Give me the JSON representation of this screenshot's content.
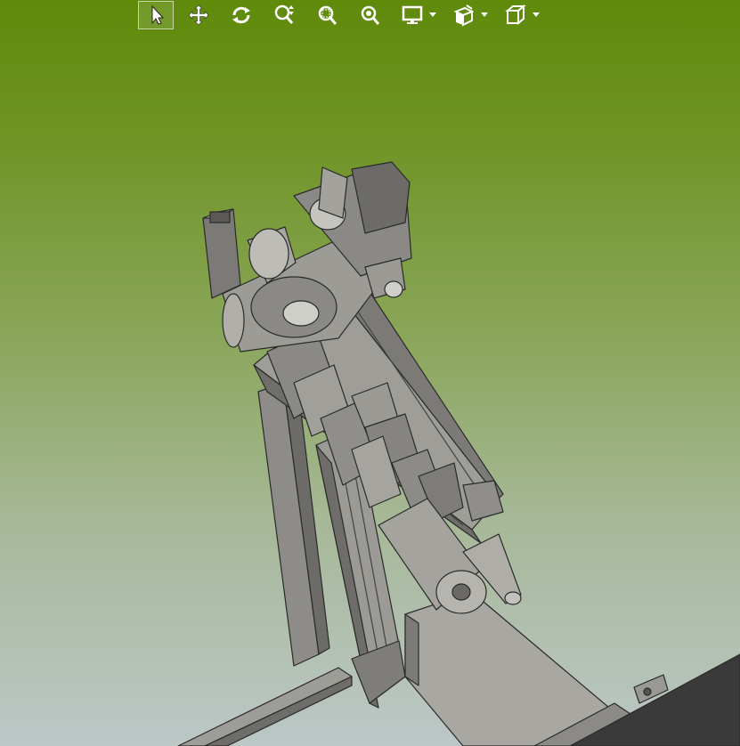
{
  "toolbar": {
    "tools": [
      {
        "name": "select-tool",
        "icon": "arrow-pointer-icon",
        "active": true
      },
      {
        "name": "pan-tool",
        "icon": "move-arrows-icon"
      },
      {
        "name": "rotate-tool",
        "icon": "rotate-icon"
      },
      {
        "name": "zoom-updown-tool",
        "icon": "zoom-updown-icon"
      },
      {
        "name": "zoom-window-tool",
        "icon": "zoom-window-icon"
      },
      {
        "name": "zoom-fit-tool",
        "icon": "zoom-fit-icon"
      },
      {
        "name": "display-style-tool",
        "icon": "monitor-icon",
        "dropdown": true
      },
      {
        "name": "section-view-tool",
        "icon": "section-view-icon",
        "dropdown": true
      },
      {
        "name": "view-orientation-tool",
        "icon": "cube-icon",
        "dropdown": true
      }
    ]
  },
  "viewport": {
    "background_top": "#5f8a0a",
    "background_bottom": "#bcc7c7",
    "model_color": "#8e8e8e",
    "model_edge_color": "#2a2a2a"
  }
}
